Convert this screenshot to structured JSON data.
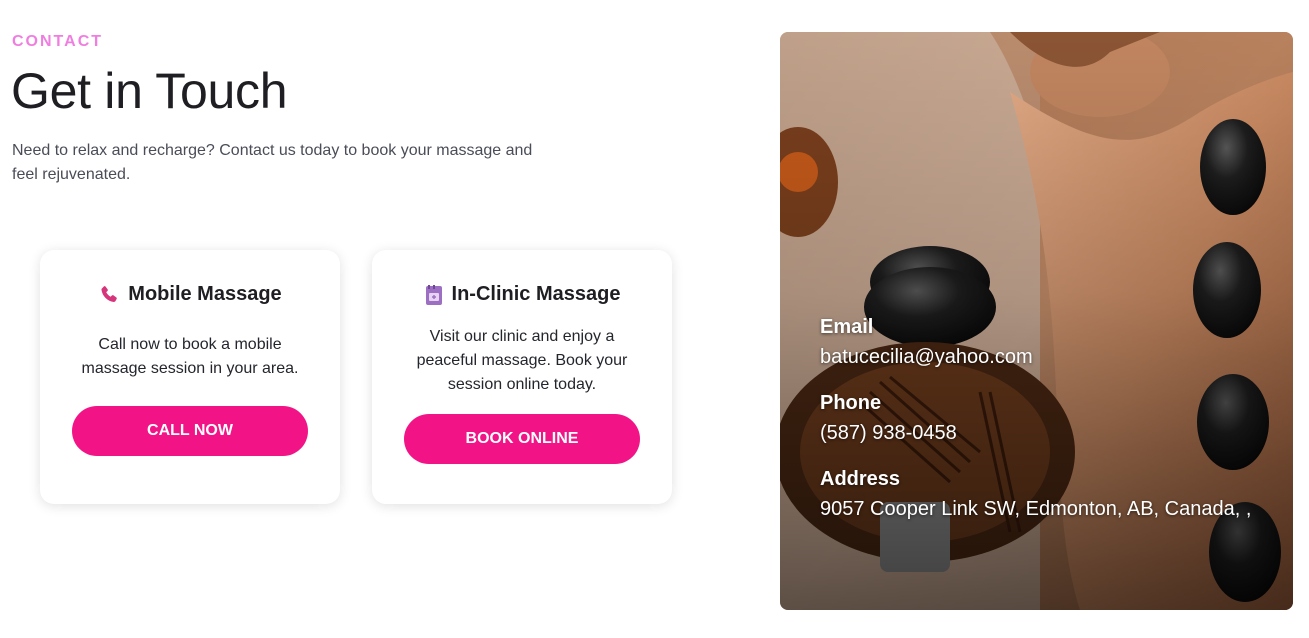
{
  "header": {
    "eyebrow": "CONTACT",
    "title": "Get in Touch",
    "intro": "Need to relax and recharge? Contact us today to book your massage and feel rejuvenated."
  },
  "cards": [
    {
      "title": "Mobile Massage",
      "icon": "phone-icon",
      "text": "Call now to book a mobile massage session in your area.",
      "button": "CALL NOW"
    },
    {
      "title": "In-Clinic Massage",
      "icon": "planner-icon",
      "text": "Visit our clinic and enjoy a peaceful massage. Book your session online today.",
      "button": "BOOK ONLINE"
    }
  ],
  "contact": {
    "email_label": "Email",
    "email": "batucecilia@yahoo.com",
    "phone_label": "Phone",
    "phone": "(587) 938-0458",
    "address_label": "Address",
    "address": "9057 Cooper Link SW, Edmonton, AB, Canada, ,"
  },
  "colors": {
    "accent": "#f21486",
    "eyebrow": "#f07ee0",
    "text": "#1e1e23"
  }
}
